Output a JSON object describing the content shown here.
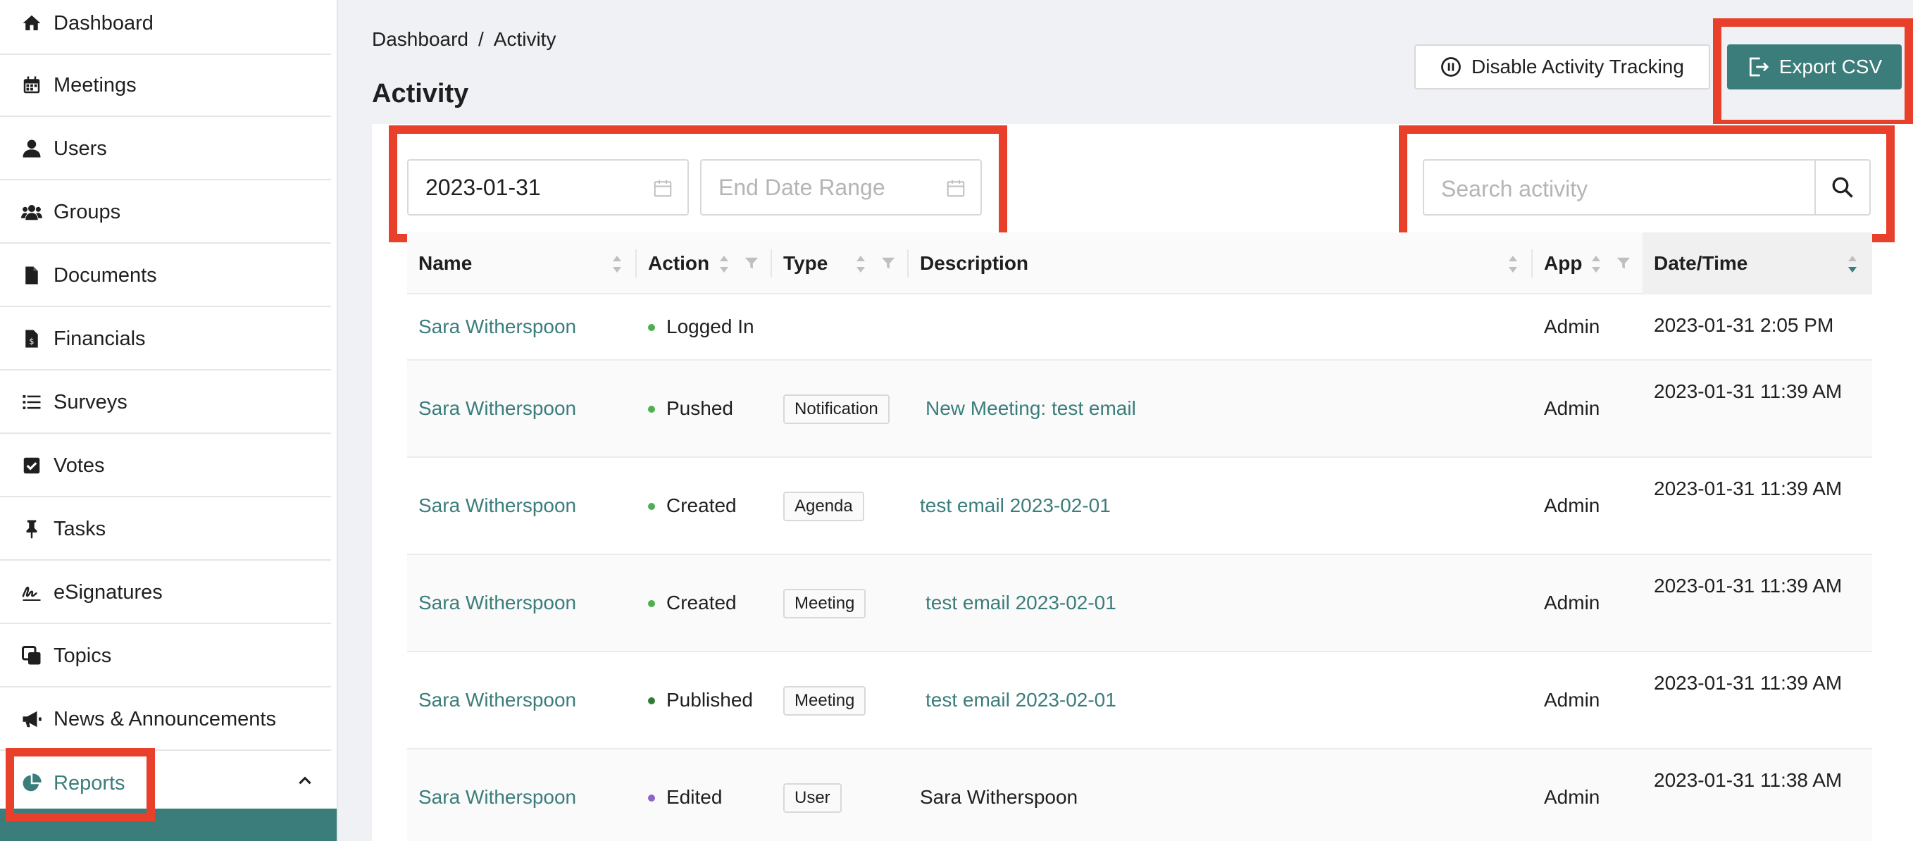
{
  "sidebar": {
    "items": [
      {
        "label": "Dashboard",
        "icon": "home-icon"
      },
      {
        "label": "Meetings",
        "icon": "calendar-icon"
      },
      {
        "label": "Users",
        "icon": "user-icon"
      },
      {
        "label": "Groups",
        "icon": "users-icon"
      },
      {
        "label": "Documents",
        "icon": "file-icon"
      },
      {
        "label": "Financials",
        "icon": "file-dollar-icon"
      },
      {
        "label": "Surveys",
        "icon": "list-icon"
      },
      {
        "label": "Votes",
        "icon": "check-square-icon"
      },
      {
        "label": "Tasks",
        "icon": "pin-icon"
      },
      {
        "label": "eSignatures",
        "icon": "signature-icon"
      },
      {
        "label": "Topics",
        "icon": "clone-icon"
      },
      {
        "label": "News & Announcements",
        "icon": "megaphone-icon"
      },
      {
        "label": "Reports",
        "icon": "pie-chart-icon"
      }
    ]
  },
  "breadcrumb": {
    "home": "Dashboard",
    "separator": "/",
    "current": "Activity"
  },
  "page": {
    "title": "Activity"
  },
  "toolbar": {
    "disable_label": "Disable Activity Tracking",
    "export_label": "Export CSV"
  },
  "filters": {
    "start_date": "2023-01-31",
    "end_placeholder": "End Date Range",
    "search_placeholder": "Search activity"
  },
  "table": {
    "columns": [
      "Name",
      "Action",
      "Type",
      "Description",
      "App",
      "Date/Time"
    ],
    "rows": [
      {
        "name": "Sara Witherspoon",
        "action": "Logged In",
        "type": "",
        "description": "",
        "app": "Admin",
        "datetime": "2023-01-31 2:05 PM"
      },
      {
        "name": "Sara Witherspoon",
        "action": "Pushed",
        "type": "Notification",
        "description": "New Meeting: test email",
        "app": "Admin",
        "datetime": "2023-01-31 11:39 AM"
      },
      {
        "name": "Sara Witherspoon",
        "action": "Created",
        "type": "Agenda",
        "description": "test email 2023-02-01",
        "app": "Admin",
        "datetime": "2023-01-31 11:39 AM"
      },
      {
        "name": "Sara Witherspoon",
        "action": "Created",
        "type": "Meeting",
        "description": "test email 2023-02-01",
        "app": "Admin",
        "datetime": "2023-01-31 11:39 AM"
      },
      {
        "name": "Sara Witherspoon",
        "action": "Published",
        "type": "Meeting",
        "description": "test email 2023-02-01",
        "app": "Admin",
        "datetime": "2023-01-31 11:39 AM"
      },
      {
        "name": "Sara Witherspoon",
        "action": "Edited",
        "type": "User",
        "description": "Sara Witherspoon",
        "app": "Admin",
        "datetime": "2023-01-31 11:38 AM"
      }
    ]
  },
  "colors": {
    "accent": "#3a7d7b",
    "highlight": "#e8402a",
    "dot_green": "#4caf50",
    "dot_darkgreen": "#2e7d32",
    "dot_purple": "#8e63c7"
  }
}
